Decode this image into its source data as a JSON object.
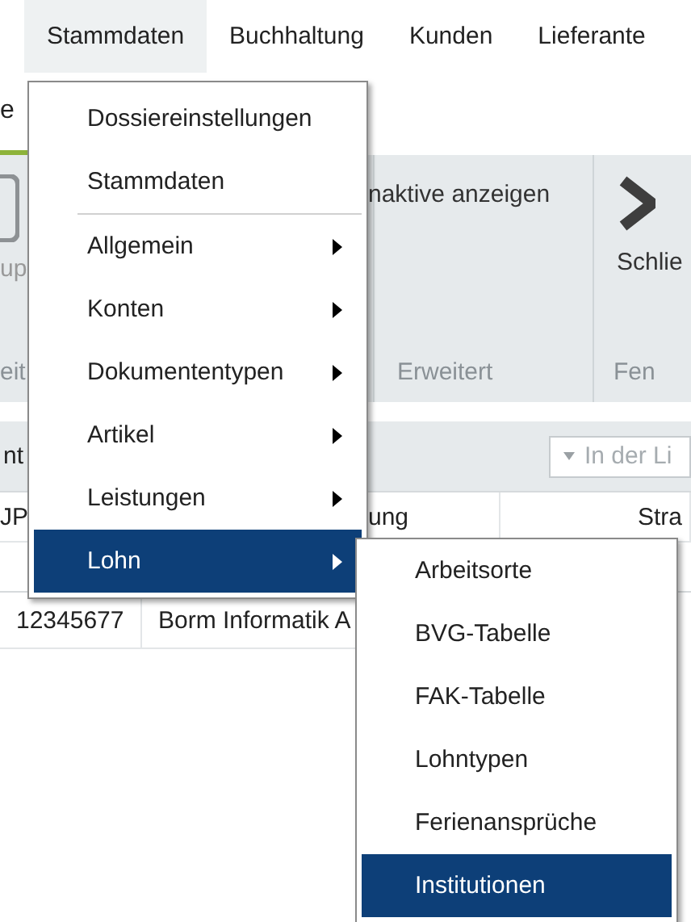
{
  "menubar": [
    {
      "label": "Stammdaten",
      "selected": true
    },
    {
      "label": "Buchhaltung",
      "selected": false
    },
    {
      "label": "Kunden",
      "selected": false
    },
    {
      "label": "Lieferante",
      "selected": false
    }
  ],
  "tab_strip": {
    "label": "e"
  },
  "ribbon": {
    "left_button": "up",
    "filter_label": "naktive anzeigen",
    "close_button": "Schlie",
    "groups": [
      "eit",
      "Erweitert",
      "Fen"
    ]
  },
  "toolbar": {
    "label": "nt",
    "search": {
      "placeholder": "In der Li"
    }
  },
  "grid": {
    "columns": [
      "JP",
      "ung",
      "Stra"
    ],
    "rows": [
      [
        "12345677",
        "Borm Informatik A"
      ]
    ]
  },
  "menu": {
    "items": [
      {
        "kind": "item",
        "label": "Dossiereinstellungen",
        "submenu": false,
        "selected": false
      },
      {
        "kind": "item",
        "label": "Stammdaten",
        "submenu": false,
        "selected": false
      },
      {
        "kind": "separator"
      },
      {
        "kind": "item",
        "label": "Allgemein",
        "submenu": true,
        "selected": false
      },
      {
        "kind": "item",
        "label": "Konten",
        "submenu": true,
        "selected": false
      },
      {
        "kind": "item",
        "label": "Dokumententypen",
        "submenu": true,
        "selected": false
      },
      {
        "kind": "item",
        "label": "Artikel",
        "submenu": true,
        "selected": false
      },
      {
        "kind": "item",
        "label": "Leistungen",
        "submenu": true,
        "selected": false
      },
      {
        "kind": "item",
        "label": "Lohn",
        "submenu": true,
        "selected": true
      }
    ]
  },
  "submenu": {
    "items": [
      {
        "label": "Arbeitsorte",
        "selected": false
      },
      {
        "label": "BVG-Tabelle",
        "selected": false
      },
      {
        "label": "FAK-Tabelle",
        "selected": false
      },
      {
        "label": "Lohntypen",
        "selected": false
      },
      {
        "label": "Ferienansprüche",
        "selected": false
      },
      {
        "label": "Institutionen",
        "selected": true
      }
    ]
  }
}
